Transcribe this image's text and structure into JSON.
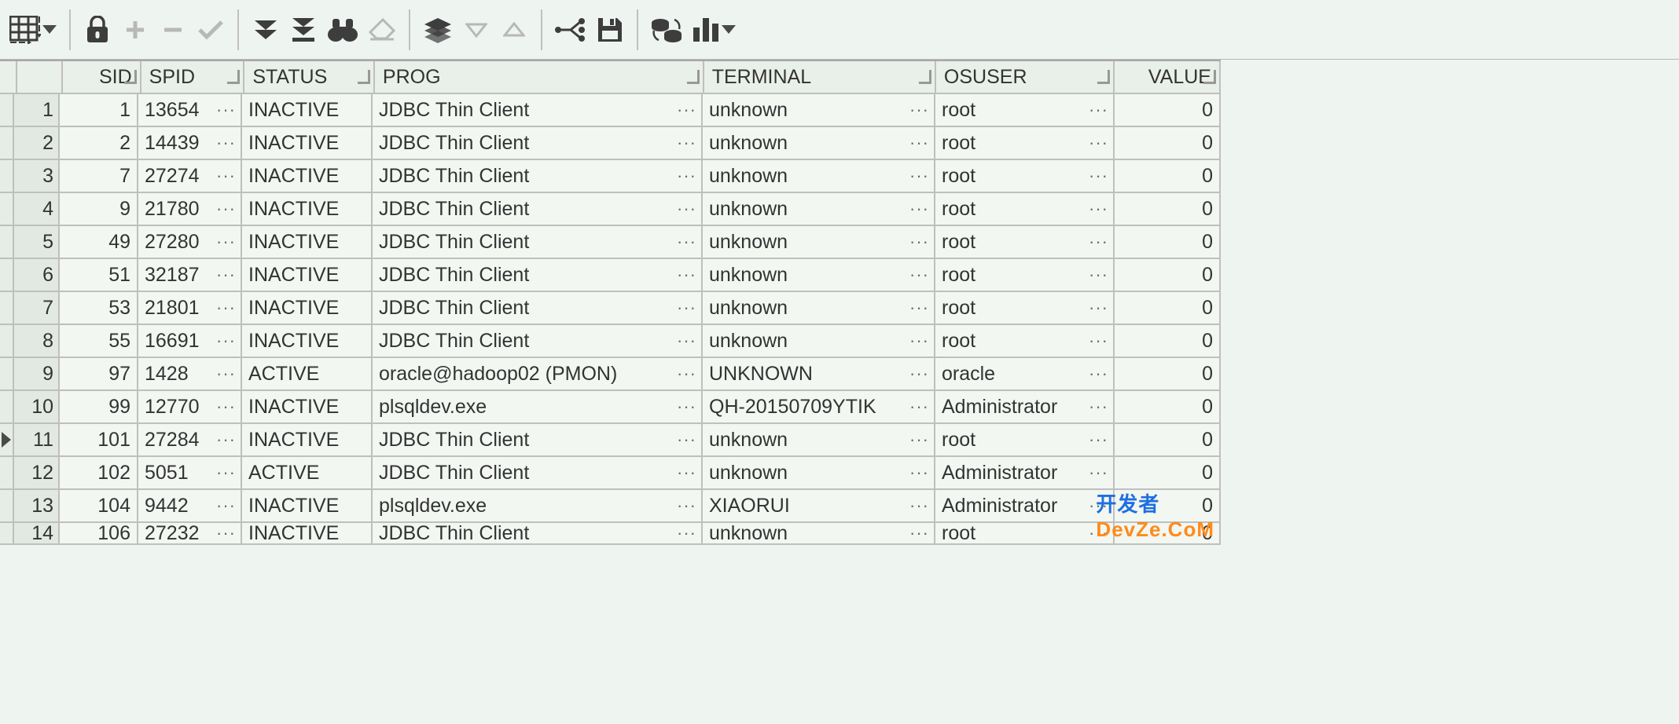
{
  "toolbar": {
    "icons": [
      "grid-options",
      "lock",
      "plus",
      "minus",
      "check",
      "collapse-down",
      "collapse-down-bar",
      "binoculars",
      "eraser",
      "layers",
      "triangle-down",
      "triangle-up",
      "connection",
      "save",
      "stack-swap",
      "library"
    ]
  },
  "columns": [
    {
      "key": "sid",
      "label": "SID"
    },
    {
      "key": "spid",
      "label": "SPID"
    },
    {
      "key": "status",
      "label": "STATUS"
    },
    {
      "key": "prog",
      "label": "PROG"
    },
    {
      "key": "term",
      "label": "TERMINAL"
    },
    {
      "key": "osuser",
      "label": "OSUSER"
    },
    {
      "key": "value",
      "label": "VALUE"
    }
  ],
  "current_row_index": 10,
  "rows": [
    {
      "n": "1",
      "sid": "1",
      "spid": "13654",
      "status": "INACTIVE",
      "prog": "JDBC Thin Client",
      "term": "unknown",
      "osuser": "root",
      "value": "0"
    },
    {
      "n": "2",
      "sid": "2",
      "spid": "14439",
      "status": "INACTIVE",
      "prog": "JDBC Thin Client",
      "term": "unknown",
      "osuser": "root",
      "value": "0"
    },
    {
      "n": "3",
      "sid": "7",
      "spid": "27274",
      "status": "INACTIVE",
      "prog": "JDBC Thin Client",
      "term": "unknown",
      "osuser": "root",
      "value": "0"
    },
    {
      "n": "4",
      "sid": "9",
      "spid": "21780",
      "status": "INACTIVE",
      "prog": "JDBC Thin Client",
      "term": "unknown",
      "osuser": "root",
      "value": "0"
    },
    {
      "n": "5",
      "sid": "49",
      "spid": "27280",
      "status": "INACTIVE",
      "prog": "JDBC Thin Client",
      "term": "unknown",
      "osuser": "root",
      "value": "0"
    },
    {
      "n": "6",
      "sid": "51",
      "spid": "32187",
      "status": "INACTIVE",
      "prog": "JDBC Thin Client",
      "term": "unknown",
      "osuser": "root",
      "value": "0"
    },
    {
      "n": "7",
      "sid": "53",
      "spid": "21801",
      "status": "INACTIVE",
      "prog": "JDBC Thin Client",
      "term": "unknown",
      "osuser": "root",
      "value": "0"
    },
    {
      "n": "8",
      "sid": "55",
      "spid": "16691",
      "status": "INACTIVE",
      "prog": "JDBC Thin Client",
      "term": "unknown",
      "osuser": "root",
      "value": "0"
    },
    {
      "n": "9",
      "sid": "97",
      "spid": "1428",
      "status": "ACTIVE",
      "prog": "oracle@hadoop02 (PMON)",
      "term": "UNKNOWN",
      "osuser": "oracle",
      "value": "0"
    },
    {
      "n": "10",
      "sid": "99",
      "spid": "12770",
      "status": "INACTIVE",
      "prog": "plsqldev.exe",
      "term": "QH-20150709YTIK",
      "osuser": "Administrator",
      "value": "0"
    },
    {
      "n": "11",
      "sid": "101",
      "spid": "27284",
      "status": "INACTIVE",
      "prog": "JDBC Thin Client",
      "term": "unknown",
      "osuser": "root",
      "value": "0"
    },
    {
      "n": "12",
      "sid": "102",
      "spid": "5051",
      "status": "ACTIVE",
      "prog": "JDBC Thin Client",
      "term": "unknown",
      "osuser": "Administrator",
      "value": "0"
    },
    {
      "n": "13",
      "sid": "104",
      "spid": "9442",
      "status": "INACTIVE",
      "prog": "plsqldev.exe",
      "term": "XIAORUI",
      "osuser": "Administrator",
      "value": "0"
    },
    {
      "n": "14",
      "sid": "106",
      "spid": "27232",
      "status": "INACTIVE",
      "prog": "JDBC Thin Client",
      "term": "unknown",
      "osuser": "root",
      "value": "0"
    }
  ],
  "watermark": {
    "text1": "开发者",
    "text2": "DevZe.CoM"
  }
}
